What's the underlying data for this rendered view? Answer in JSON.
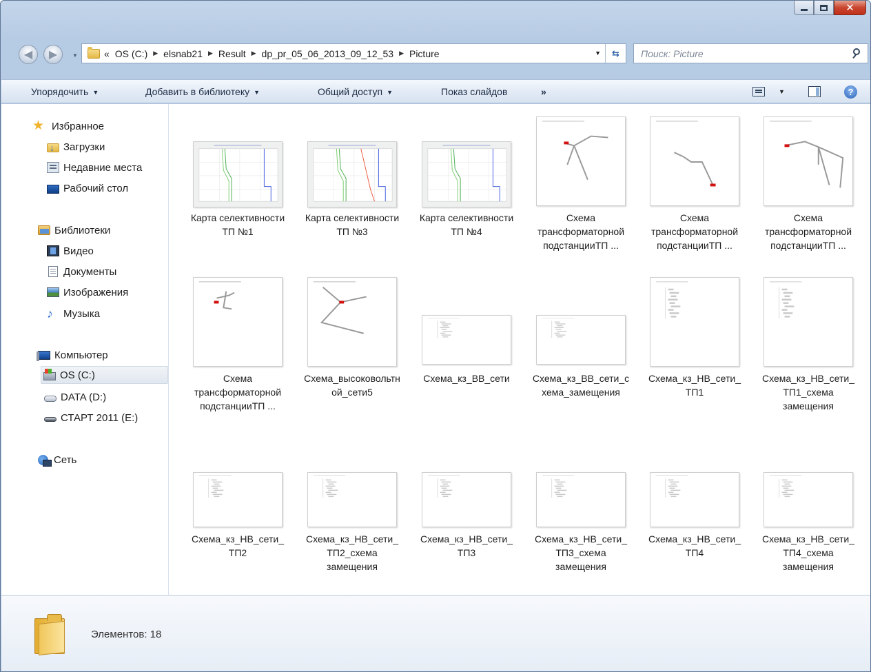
{
  "address": {
    "overflow": "«",
    "crumbs": [
      "OS (C:)",
      "elsnab21",
      "Result",
      "dp_pr_05_06_2013_09_12_53",
      "Picture"
    ]
  },
  "search": {
    "placeholder": "Поиск: Picture"
  },
  "toolbar": {
    "organize": "Упорядочить",
    "add_to_library": "Добавить в библиотеку",
    "share": "Общий доступ",
    "slideshow": "Показ слайдов",
    "more": "»"
  },
  "sidebar": {
    "favorites": "Избранное",
    "downloads": "Загрузки",
    "recent": "Недавние места",
    "desktop": "Рабочий стол",
    "libraries": "Библиотеки",
    "video": "Видео",
    "documents": "Документы",
    "images": "Изображения",
    "music": "Музыка",
    "computer": "Компьютер",
    "drive_c": "OS (C:)",
    "drive_d": "DATA (D:)",
    "drive_e": "СТАРТ 2011 (E:)",
    "network": "Сеть"
  },
  "files": [
    {
      "name": "Карта селективности ТП №1",
      "kind": "chart"
    },
    {
      "name": "Карта селективности ТП №3",
      "kind": "chart"
    },
    {
      "name": "Карта селективности ТП №4",
      "kind": "chart"
    },
    {
      "name": "Схема трансформаторной подстанцииТП ...",
      "kind": "scheme"
    },
    {
      "name": "Схема трансформаторной подстанцииТП ...",
      "kind": "scheme"
    },
    {
      "name": "Схема трансформаторной подстанцииТП ...",
      "kind": "scheme"
    },
    {
      "name": "Схема трансформаторной подстанцииТП ...",
      "kind": "scheme"
    },
    {
      "name": "Схема_высоковольтной_сети5",
      "kind": "scheme"
    },
    {
      "name": "Схема_кз_ВВ_сети",
      "kind": "list"
    },
    {
      "name": "Схема_кз_ВВ_сети_схема_замещения",
      "kind": "list"
    },
    {
      "name": "Схема_кз_НВ_сети_ТП1",
      "kind": "list"
    },
    {
      "name": "Схема_кз_НВ_сети_ТП1_схема замещения",
      "kind": "list"
    },
    {
      "name": "Схема_кз_НВ_сети_ТП2",
      "kind": "list"
    },
    {
      "name": "Схема_кз_НВ_сети_ТП2_схема замещения",
      "kind": "list"
    },
    {
      "name": "Схема_кз_НВ_сети_ТП3",
      "kind": "list"
    },
    {
      "name": "Схема_кз_НВ_сети_ТП3_схема замещения",
      "kind": "list"
    },
    {
      "name": "Схема_кз_НВ_сети_ТП4",
      "kind": "list"
    },
    {
      "name": "Схема_кз_НВ_сети_ТП4_схема замещения",
      "kind": "list"
    }
  ],
  "status": {
    "count": "Элементов: 18"
  }
}
